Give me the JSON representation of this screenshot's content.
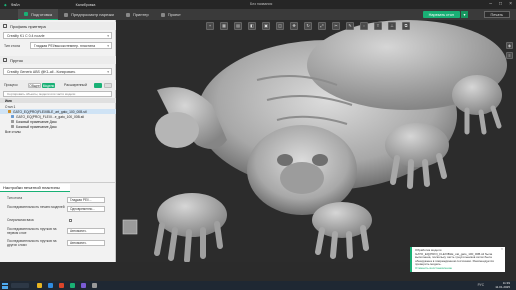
{
  "titlebar": {
    "app": "Файл",
    "app2": "Калибровка",
    "center": "Без названия"
  },
  "menubar": {
    "tabs": [
      {
        "label": "Подготовка",
        "active": true
      },
      {
        "label": "Предпросмотр нарезки",
        "active": false
      },
      {
        "label": "Принтер",
        "active": false
      },
      {
        "label": "Проект",
        "active": false
      }
    ],
    "slice_button": "Нарезать стол",
    "print_button": "Печать"
  },
  "sidebar": {
    "printer_section": "Профиль принтера",
    "printer_value": "Creality K1 C 0.4 nozzle",
    "bed_label": "Тип стола",
    "bed_value": "Гладкая PEI/высокотемпер. пластина",
    "filament_section": "Пруток",
    "filament_value": "Creality Generic ABS @K1-all - Копировать",
    "process_label": "Процесс",
    "process_modes": [
      "Общее",
      "Модели"
    ],
    "advanced_label": "Расширенный",
    "objects_filter": "Сортировать объекты, модели или части модели",
    "tree_header": "Имя",
    "tree": [
      {
        "label": "Стол 1",
        "selected": false
      },
      {
        "label": "GATO_EQ(PRO)FLEXIBLE_art_gato_100_00B.stl",
        "selected": true
      },
      {
        "label": "GATO_EQ(PRO)_FLEXI...e_gato_100_00B.stl",
        "selected": false
      },
      {
        "label": "Базовый примечание Диск",
        "selected": false
      },
      {
        "label": "Базовый примечание Диск",
        "selected": false
      },
      {
        "label": "Все столы",
        "selected": false
      }
    ],
    "plate_settings": "Настройки печатной пластины",
    "params": [
      {
        "label": "Тип стола",
        "value": "Гладкая PEI/..."
      },
      {
        "label": "Последовательность печати моделей",
        "value": "Одновременно..."
      },
      {
        "label": "Спиральная ваза",
        "value": ""
      },
      {
        "label": "Последовательность прутков на первом слое",
        "value": "Автоматич."
      },
      {
        "label": "Последовательность прутков на других слоях",
        "value": "Автоматич."
      }
    ]
  },
  "viewport": {
    "toolbar_icons": [
      "add-icon",
      "grid-icon",
      "layout-icon",
      "orient-icon",
      "arrange-icon",
      "split-icon",
      "move-icon",
      "rotate-icon",
      "scale-icon",
      "cut-icon",
      "paint-icon",
      "seam-icon",
      "text-icon",
      "measure-icon",
      "assembly-icon"
    ],
    "right_icons": [
      "view-icon",
      "slice-view-icon",
      "layers-icon",
      "settings-icon"
    ]
  },
  "notification": {
    "text": "Обработка модели GATO_EQ(PRO)_FLEXIBLE_cat_gato_100_00B.stl была выполнена, поскольку часть треугольников сетки была обнаружена в повреждённом состоянии. Рекомендуется проверить модель.",
    "link": "Отменить восстановление"
  },
  "taskbar": {
    "time": "11:39",
    "date": "11.01.2025",
    "lang": "РУС"
  },
  "colors": {
    "accent": "#19b075",
    "model": "#bdbdbd"
  }
}
